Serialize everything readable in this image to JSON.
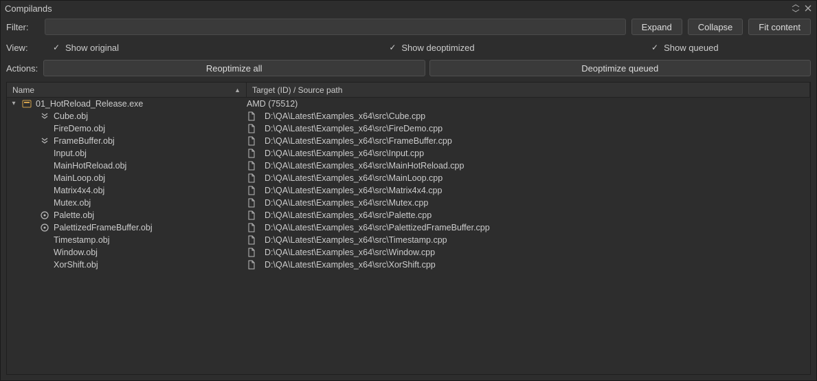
{
  "titlebar": {
    "title": "Compilands"
  },
  "filter": {
    "label": "Filter:",
    "value": ""
  },
  "buttons": {
    "expand": "Expand",
    "collapse": "Collapse",
    "fit": "Fit content"
  },
  "view": {
    "label": "View:",
    "options": [
      {
        "label": "Show original",
        "checked": true
      },
      {
        "label": "Show deoptimized",
        "checked": true
      },
      {
        "label": "Show queued",
        "checked": true
      }
    ]
  },
  "actions": {
    "label": "Actions:",
    "reoptimize": "Reoptimize all",
    "deoptimize": "Deoptimize queued"
  },
  "columns": {
    "name": "Name",
    "path": "Target (ID) / Source path",
    "sort": "▲"
  },
  "tree": {
    "root": {
      "name": "01_HotReload_Release.exe",
      "target": "AMD (75512)"
    },
    "children": [
      {
        "name": "Cube.obj",
        "path": "D:\\QA\\Latest\\Examples_x64\\src\\Cube.cpp",
        "icon": "chevrons"
      },
      {
        "name": "FireDemo.obj",
        "path": "D:\\QA\\Latest\\Examples_x64\\src\\FireDemo.cpp",
        "icon": "none"
      },
      {
        "name": "FrameBuffer.obj",
        "path": "D:\\QA\\Latest\\Examples_x64\\src\\FrameBuffer.cpp",
        "icon": "chevrons"
      },
      {
        "name": "Input.obj",
        "path": "D:\\QA\\Latest\\Examples_x64\\src\\Input.cpp",
        "icon": "none"
      },
      {
        "name": "MainHotReload.obj",
        "path": "D:\\QA\\Latest\\Examples_x64\\src\\MainHotReload.cpp",
        "icon": "none"
      },
      {
        "name": "MainLoop.obj",
        "path": "D:\\QA\\Latest\\Examples_x64\\src\\MainLoop.cpp",
        "icon": "none"
      },
      {
        "name": "Matrix4x4.obj",
        "path": "D:\\QA\\Latest\\Examples_x64\\src\\Matrix4x4.cpp",
        "icon": "none"
      },
      {
        "name": "Mutex.obj",
        "path": "D:\\QA\\Latest\\Examples_x64\\src\\Mutex.cpp",
        "icon": "none"
      },
      {
        "name": "Palette.obj",
        "path": "D:\\QA\\Latest\\Examples_x64\\src\\Palette.cpp",
        "icon": "circle"
      },
      {
        "name": "PalettizedFrameBuffer.obj",
        "path": "D:\\QA\\Latest\\Examples_x64\\src\\PalettizedFrameBuffer.cpp",
        "icon": "circle"
      },
      {
        "name": "Timestamp.obj",
        "path": "D:\\QA\\Latest\\Examples_x64\\src\\Timestamp.cpp",
        "icon": "none"
      },
      {
        "name": "Window.obj",
        "path": "D:\\QA\\Latest\\Examples_x64\\src\\Window.cpp",
        "icon": "none"
      },
      {
        "name": "XorShift.obj",
        "path": "D:\\QA\\Latest\\Examples_x64\\src\\XorShift.cpp",
        "icon": "none"
      }
    ]
  }
}
